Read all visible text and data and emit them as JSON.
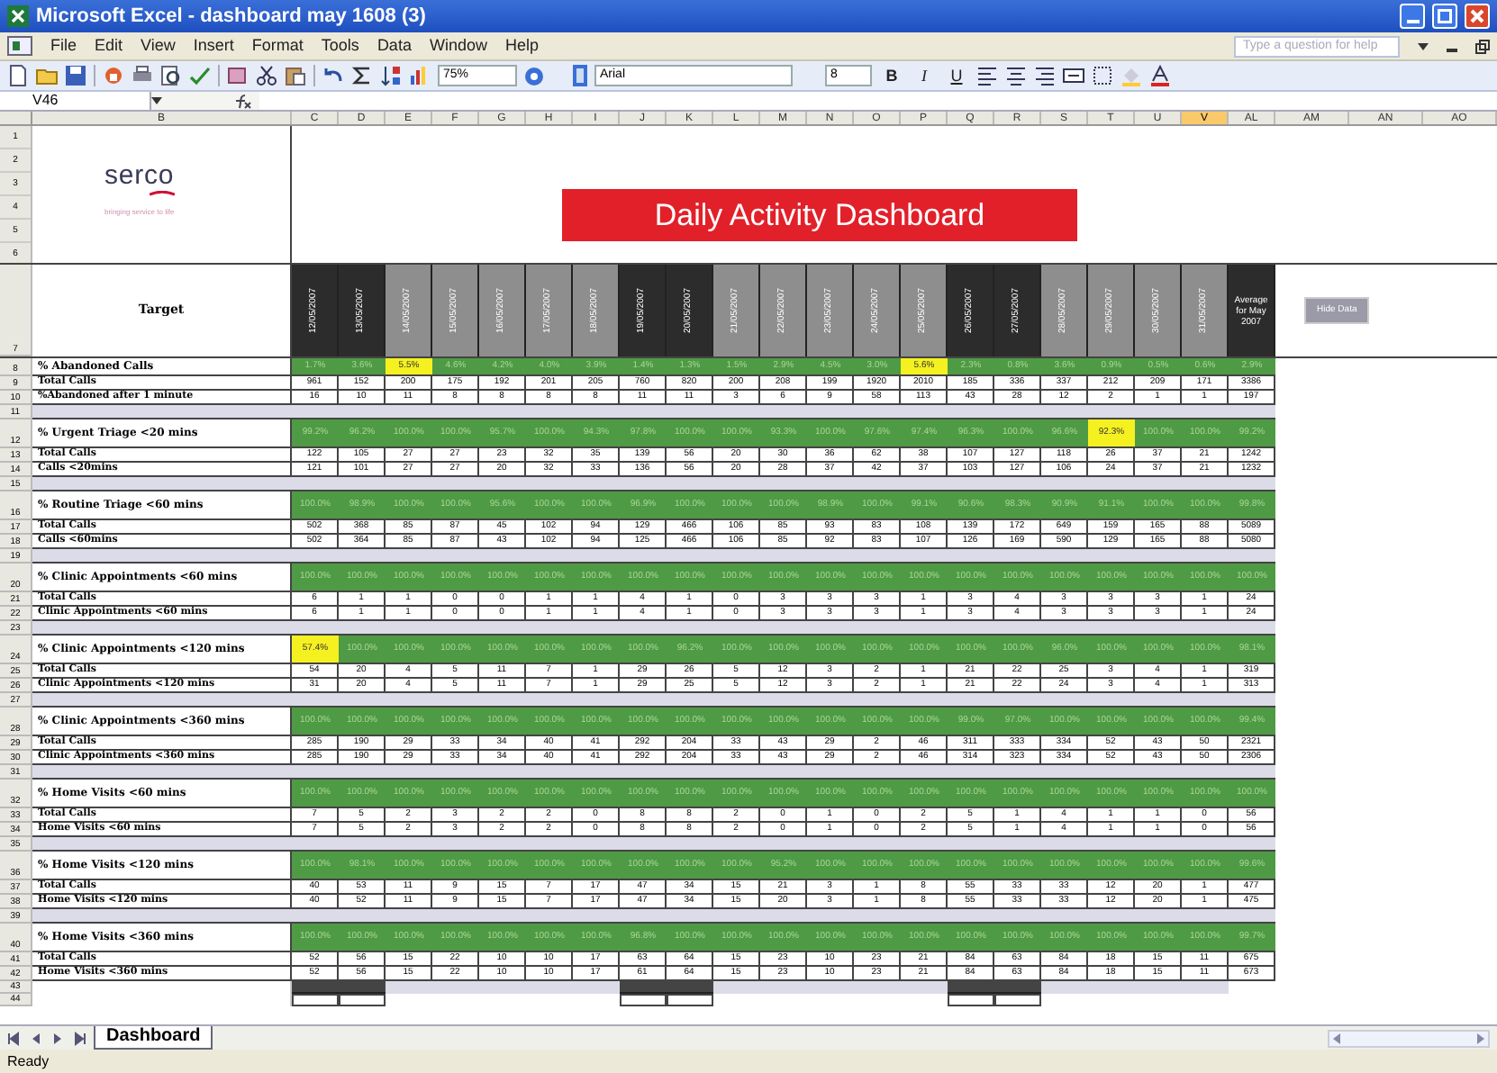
{
  "window": {
    "title": "Microsoft Excel - dashboard may 1608 (3)"
  },
  "menu": [
    "File",
    "Edit",
    "View",
    "Insert",
    "Format",
    "Tools",
    "Data",
    "Window",
    "Help"
  ],
  "help_search": {
    "placeholder": "Type a question for help"
  },
  "toolbar": {
    "zoom": "75%",
    "font": "Arial",
    "font_size": "8",
    "format_buttons": [
      "B",
      "I",
      "U"
    ]
  },
  "name_box": "V46",
  "column_headers": [
    {
      "label": "B",
      "selected": false
    },
    {
      "label": "C",
      "selected": false
    },
    {
      "label": "D",
      "selected": false
    },
    {
      "label": "E",
      "selected": false
    },
    {
      "label": "F",
      "selected": false
    },
    {
      "label": "G",
      "selected": false
    },
    {
      "label": "H",
      "selected": false
    },
    {
      "label": "I",
      "selected": false
    },
    {
      "label": "J",
      "selected": false
    },
    {
      "label": "K",
      "selected": false
    },
    {
      "label": "L",
      "selected": false
    },
    {
      "label": "M",
      "selected": false
    },
    {
      "label": "N",
      "selected": false
    },
    {
      "label": "O",
      "selected": false
    },
    {
      "label": "P",
      "selected": false
    },
    {
      "label": "Q",
      "selected": false
    },
    {
      "label": "R",
      "selected": false
    },
    {
      "label": "S",
      "selected": false
    },
    {
      "label": "T",
      "selected": false
    },
    {
      "label": "U",
      "selected": false
    },
    {
      "label": "V",
      "selected": true
    },
    {
      "label": "AL",
      "selected": false
    },
    {
      "label": "AM",
      "selected": false
    },
    {
      "label": "AN",
      "selected": false
    },
    {
      "label": "AO",
      "selected": false
    }
  ],
  "logo": {
    "name": "serco",
    "tagline": "bringing service to life"
  },
  "banner": "Daily Activity Dashboard",
  "header_row_numbers": [
    "1",
    "2",
    "3",
    "4",
    "5",
    "6"
  ],
  "date_row": {
    "row_number": "7",
    "label": "Target",
    "average_label": "Average for May 2007"
  },
  "dates": [
    {
      "label": "12/05/2007",
      "weekend": true
    },
    {
      "label": "13/05/2007",
      "weekend": true
    },
    {
      "label": "14/05/2007",
      "weekend": false
    },
    {
      "label": "15/05/2007",
      "weekend": false
    },
    {
      "label": "16/05/2007",
      "weekend": false
    },
    {
      "label": "17/05/2007",
      "weekend": false
    },
    {
      "label": "18/05/2007",
      "weekend": false
    },
    {
      "label": "19/05/2007",
      "weekend": true
    },
    {
      "label": "20/05/2007",
      "weekend": true
    },
    {
      "label": "21/05/2007",
      "weekend": false
    },
    {
      "label": "22/05/2007",
      "weekend": false
    },
    {
      "label": "23/05/2007",
      "weekend": false
    },
    {
      "label": "24/05/2007",
      "weekend": false
    },
    {
      "label": "25/05/2007",
      "weekend": false
    },
    {
      "label": "26/05/2007",
      "weekend": true
    },
    {
      "label": "27/05/2007",
      "weekend": true
    },
    {
      "label": "28/05/2007",
      "weekend": false
    },
    {
      "label": "29/05/2007",
      "weekend": false
    },
    {
      "label": "30/05/2007",
      "weekend": false
    },
    {
      "label": "31/05/2007",
      "weekend": false
    }
  ],
  "hide_button": "Hide Data",
  "sections": [
    {
      "row_number": "8",
      "title": "% Abandoned Calls",
      "cells": [
        {
          "v": "1.7%",
          "flagged": false
        },
        {
          "v": "3.6%",
          "flagged": false
        },
        {
          "v": "5.5%",
          "flagged": true
        },
        {
          "v": "4.6%",
          "flagged": false
        },
        {
          "v": "4.2%",
          "flagged": false
        },
        {
          "v": "4.0%",
          "flagged": false
        },
        {
          "v": "3.9%",
          "flagged": false
        },
        {
          "v": "1.4%",
          "flagged": false
        },
        {
          "v": "1.3%",
          "flagged": false
        },
        {
          "v": "1.5%",
          "flagged": false
        },
        {
          "v": "2.9%",
          "flagged": false
        },
        {
          "v": "4.5%",
          "flagged": false
        },
        {
          "v": "3.0%",
          "flagged": false
        },
        {
          "v": "5.6%",
          "flagged": true
        },
        {
          "v": "2.3%",
          "flagged": false
        },
        {
          "v": "0.8%",
          "flagged": false
        },
        {
          "v": "3.6%",
          "flagged": false
        },
        {
          "v": "0.9%",
          "flagged": false
        },
        {
          "v": "0.5%",
          "flagged": false
        },
        {
          "v": "0.6%",
          "flagged": false
        },
        {
          "v": "2.9%",
          "flagged": false
        }
      ],
      "rows": [
        {
          "row_number": "9",
          "label": "Total Calls",
          "values": [
            "961",
            "152",
            "200",
            "175",
            "192",
            "201",
            "205",
            "760",
            "820",
            "200",
            "208",
            "199",
            "1920",
            "2010",
            "185",
            "336",
            "337",
            "212",
            "209",
            "171",
            "3386"
          ]
        },
        {
          "row_number": "10",
          "label": "%Abandoned after 1 minute",
          "values": [
            "16",
            "10",
            "11",
            "8",
            "8",
            "8",
            "8",
            "11",
            "11",
            "3",
            "6",
            "9",
            "58",
            "113",
            "43",
            "28",
            "12",
            "2",
            "1",
            "1",
            "197"
          ]
        }
      ],
      "spacer": "11"
    },
    {
      "row_number": "12",
      "title": "% Urgent Triage <20 mins",
      "cells": [
        {
          "v": "99.2%",
          "flagged": false
        },
        {
          "v": "96.2%",
          "flagged": false
        },
        {
          "v": "100.0%",
          "flagged": false
        },
        {
          "v": "100.0%",
          "flagged": false
        },
        {
          "v": "95.7%",
          "flagged": false
        },
        {
          "v": "100.0%",
          "flagged": false
        },
        {
          "v": "94.3%",
          "flagged": false
        },
        {
          "v": "97.8%",
          "flagged": false
        },
        {
          "v": "100.0%",
          "flagged": false
        },
        {
          "v": "100.0%",
          "flagged": false
        },
        {
          "v": "93.3%",
          "flagged": false
        },
        {
          "v": "100.0%",
          "flagged": false
        },
        {
          "v": "97.6%",
          "flagged": false
        },
        {
          "v": "97.4%",
          "flagged": false
        },
        {
          "v": "96.3%",
          "flagged": false
        },
        {
          "v": "100.0%",
          "flagged": false
        },
        {
          "v": "96.6%",
          "flagged": false
        },
        {
          "v": "92.3%",
          "flagged": true
        },
        {
          "v": "100.0%",
          "flagged": false
        },
        {
          "v": "100.0%",
          "flagged": false
        },
        {
          "v": "99.2%",
          "flagged": false
        }
      ],
      "rows": [
        {
          "row_number": "13",
          "label": "Total Calls",
          "values": [
            "122",
            "105",
            "27",
            "27",
            "23",
            "32",
            "35",
            "139",
            "56",
            "20",
            "30",
            "36",
            "62",
            "38",
            "107",
            "127",
            "118",
            "26",
            "37",
            "21",
            "1242"
          ]
        },
        {
          "row_number": "14",
          "label": "Calls <20mins",
          "values": [
            "121",
            "101",
            "27",
            "27",
            "20",
            "32",
            "33",
            "136",
            "56",
            "20",
            "28",
            "37",
            "42",
            "37",
            "103",
            "127",
            "106",
            "24",
            "37",
            "21",
            "1232"
          ]
        }
      ],
      "spacer": "15"
    },
    {
      "row_number": "16",
      "title": "% Routine Triage <60 mins",
      "cells": [
        {
          "v": "100.0%",
          "flagged": false
        },
        {
          "v": "98.9%",
          "flagged": false
        },
        {
          "v": "100.0%",
          "flagged": false
        },
        {
          "v": "100.0%",
          "flagged": false
        },
        {
          "v": "95.6%",
          "flagged": false
        },
        {
          "v": "100.0%",
          "flagged": false
        },
        {
          "v": "100.0%",
          "flagged": false
        },
        {
          "v": "96.9%",
          "flagged": false
        },
        {
          "v": "100.0%",
          "flagged": false
        },
        {
          "v": "100.0%",
          "flagged": false
        },
        {
          "v": "100.0%",
          "flagged": false
        },
        {
          "v": "98.9%",
          "flagged": false
        },
        {
          "v": "100.0%",
          "flagged": false
        },
        {
          "v": "99.1%",
          "flagged": false
        },
        {
          "v": "90.6%",
          "flagged": false
        },
        {
          "v": "98.3%",
          "flagged": false
        },
        {
          "v": "90.9%",
          "flagged": false
        },
        {
          "v": "91.1%",
          "flagged": false
        },
        {
          "v": "100.0%",
          "flagged": false
        },
        {
          "v": "100.0%",
          "flagged": false
        },
        {
          "v": "99.8%",
          "flagged": false
        }
      ],
      "rows": [
        {
          "row_number": "17",
          "label": "Total Calls",
          "values": [
            "502",
            "368",
            "85",
            "87",
            "45",
            "102",
            "94",
            "129",
            "466",
            "106",
            "85",
            "93",
            "83",
            "108",
            "139",
            "172",
            "649",
            "159",
            "165",
            "88",
            "5089"
          ]
        },
        {
          "row_number": "18",
          "label": "Calls <60mins",
          "values": [
            "502",
            "364",
            "85",
            "87",
            "43",
            "102",
            "94",
            "125",
            "466",
            "106",
            "85",
            "92",
            "83",
            "107",
            "126",
            "169",
            "590",
            "129",
            "165",
            "88",
            "5080"
          ]
        }
      ],
      "spacer": "19"
    },
    {
      "row_number": "20",
      "title": "% Clinic Appointments <60 mins",
      "cells": [
        {
          "v": "100.0%",
          "flagged": false
        },
        {
          "v": "100.0%",
          "flagged": false
        },
        {
          "v": "100.0%",
          "flagged": false
        },
        {
          "v": "100.0%",
          "flagged": false
        },
        {
          "v": "100.0%",
          "flagged": false
        },
        {
          "v": "100.0%",
          "flagged": false
        },
        {
          "v": "100.0%",
          "flagged": false
        },
        {
          "v": "100.0%",
          "flagged": false
        },
        {
          "v": "100.0%",
          "flagged": false
        },
        {
          "v": "100.0%",
          "flagged": false
        },
        {
          "v": "100.0%",
          "flagged": false
        },
        {
          "v": "100.0%",
          "flagged": false
        },
        {
          "v": "100.0%",
          "flagged": false
        },
        {
          "v": "100.0%",
          "flagged": false
        },
        {
          "v": "100.0%",
          "flagged": false
        },
        {
          "v": "100.0%",
          "flagged": false
        },
        {
          "v": "100.0%",
          "flagged": false
        },
        {
          "v": "100.0%",
          "flagged": false
        },
        {
          "v": "100.0%",
          "flagged": false
        },
        {
          "v": "100.0%",
          "flagged": false
        },
        {
          "v": "100.0%",
          "flagged": false
        }
      ],
      "rows": [
        {
          "row_number": "21",
          "label": "Total Calls",
          "values": [
            "6",
            "1",
            "1",
            "0",
            "0",
            "1",
            "1",
            "4",
            "1",
            "0",
            "3",
            "3",
            "3",
            "1",
            "3",
            "4",
            "3",
            "3",
            "3",
            "1",
            "24"
          ]
        },
        {
          "row_number": "22",
          "label": "Clinic Appointments <60 mins",
          "values": [
            "6",
            "1",
            "1",
            "0",
            "0",
            "1",
            "1",
            "4",
            "1",
            "0",
            "3",
            "3",
            "3",
            "1",
            "3",
            "4",
            "3",
            "3",
            "3",
            "1",
            "24"
          ]
        }
      ],
      "spacer": "23"
    },
    {
      "row_number": "24",
      "title": "% Clinic Appointments <120 mins",
      "cells": [
        {
          "v": "57.4%",
          "flagged": true
        },
        {
          "v": "100.0%",
          "flagged": false
        },
        {
          "v": "100.0%",
          "flagged": false
        },
        {
          "v": "100.0%",
          "flagged": false
        },
        {
          "v": "100.0%",
          "flagged": false
        },
        {
          "v": "100.0%",
          "flagged": false
        },
        {
          "v": "100.0%",
          "flagged": false
        },
        {
          "v": "100.0%",
          "flagged": false
        },
        {
          "v": "96.2%",
          "flagged": false
        },
        {
          "v": "100.0%",
          "flagged": false
        },
        {
          "v": "100.0%",
          "flagged": false
        },
        {
          "v": "100.0%",
          "flagged": false
        },
        {
          "v": "100.0%",
          "flagged": false
        },
        {
          "v": "100.0%",
          "flagged": false
        },
        {
          "v": "100.0%",
          "flagged": false
        },
        {
          "v": "100.0%",
          "flagged": false
        },
        {
          "v": "96.0%",
          "flagged": false
        },
        {
          "v": "100.0%",
          "flagged": false
        },
        {
          "v": "100.0%",
          "flagged": false
        },
        {
          "v": "100.0%",
          "flagged": false
        },
        {
          "v": "98.1%",
          "flagged": false
        }
      ],
      "rows": [
        {
          "row_number": "25",
          "label": "Total Calls",
          "values": [
            "54",
            "20",
            "4",
            "5",
            "11",
            "7",
            "1",
            "29",
            "26",
            "5",
            "12",
            "3",
            "2",
            "1",
            "21",
            "22",
            "25",
            "3",
            "4",
            "1",
            "319"
          ]
        },
        {
          "row_number": "26",
          "label": "Clinic Appointments **<120** mins",
          "values": [
            "31",
            "20",
            "4",
            "5",
            "11",
            "7",
            "1",
            "29",
            "25",
            "5",
            "12",
            "3",
            "2",
            "1",
            "21",
            "22",
            "24",
            "3",
            "4",
            "1",
            "313"
          ]
        }
      ],
      "spacer": "27"
    },
    {
      "row_number": "28",
      "title": "% Clinic Appointments <360 mins",
      "cells": [
        {
          "v": "100.0%",
          "flagged": false
        },
        {
          "v": "100.0%",
          "flagged": false
        },
        {
          "v": "100.0%",
          "flagged": false
        },
        {
          "v": "100.0%",
          "flagged": false
        },
        {
          "v": "100.0%",
          "flagged": false
        },
        {
          "v": "100.0%",
          "flagged": false
        },
        {
          "v": "100.0%",
          "flagged": false
        },
        {
          "v": "100.0%",
          "flagged": false
        },
        {
          "v": "100.0%",
          "flagged": false
        },
        {
          "v": "100.0%",
          "flagged": false
        },
        {
          "v": "100.0%",
          "flagged": false
        },
        {
          "v": "100.0%",
          "flagged": false
        },
        {
          "v": "100.0%",
          "flagged": false
        },
        {
          "v": "100.0%",
          "flagged": false
        },
        {
          "v": "99.0%",
          "flagged": false
        },
        {
          "v": "97.0%",
          "flagged": false
        },
        {
          "v": "100.0%",
          "flagged": false
        },
        {
          "v": "100.0%",
          "flagged": false
        },
        {
          "v": "100.0%",
          "flagged": false
        },
        {
          "v": "100.0%",
          "flagged": false
        },
        {
          "v": "99.4%",
          "flagged": false
        }
      ],
      "rows": [
        {
          "row_number": "29",
          "label": "Total Calls",
          "values": [
            "285",
            "190",
            "29",
            "33",
            "34",
            "40",
            "41",
            "292",
            "204",
            "33",
            "43",
            "29",
            "2",
            "46",
            "311",
            "333",
            "334",
            "52",
            "43",
            "50",
            "2321"
          ]
        },
        {
          "row_number": "30",
          "label": "Clinic Appointments <360 mins",
          "values": [
            "285",
            "190",
            "29",
            "33",
            "34",
            "40",
            "41",
            "292",
            "204",
            "33",
            "43",
            "29",
            "2",
            "46",
            "314",
            "323",
            "334",
            "52",
            "43",
            "50",
            "2306"
          ]
        }
      ],
      "spacer": "31"
    },
    {
      "row_number": "32",
      "title": "% Home Visits <60 mins",
      "cells": [
        {
          "v": "100.0%",
          "flagged": false
        },
        {
          "v": "100.0%",
          "flagged": false
        },
        {
          "v": "100.0%",
          "flagged": false
        },
        {
          "v": "100.0%",
          "flagged": false
        },
        {
          "v": "100.0%",
          "flagged": false
        },
        {
          "v": "100.0%",
          "flagged": false
        },
        {
          "v": "100.0%",
          "flagged": false
        },
        {
          "v": "100.0%",
          "flagged": false
        },
        {
          "v": "100.0%",
          "flagged": false
        },
        {
          "v": "100.0%",
          "flagged": false
        },
        {
          "v": "100.0%",
          "flagged": false
        },
        {
          "v": "100.0%",
          "flagged": false
        },
        {
          "v": "100.0%",
          "flagged": false
        },
        {
          "v": "100.0%",
          "flagged": false
        },
        {
          "v": "100.0%",
          "flagged": false
        },
        {
          "v": "100.0%",
          "flagged": false
        },
        {
          "v": "100.0%",
          "flagged": false
        },
        {
          "v": "100.0%",
          "flagged": false
        },
        {
          "v": "100.0%",
          "flagged": false
        },
        {
          "v": "100.0%",
          "flagged": false
        },
        {
          "v": "100.0%",
          "flagged": false
        }
      ],
      "rows": [
        {
          "row_number": "33",
          "label": "Total Calls",
          "values": [
            "7",
            "5",
            "2",
            "3",
            "2",
            "2",
            "0",
            "8",
            "8",
            "2",
            "0",
            "1",
            "0",
            "2",
            "5",
            "1",
            "4",
            "1",
            "1",
            "0",
            "56"
          ]
        },
        {
          "row_number": "34",
          "label": "Home Visits <60 mins",
          "values": [
            "7",
            "5",
            "2",
            "3",
            "2",
            "2",
            "0",
            "8",
            "8",
            "2",
            "0",
            "1",
            "0",
            "2",
            "5",
            "1",
            "4",
            "1",
            "1",
            "0",
            "56"
          ]
        }
      ],
      "spacer": "35"
    },
    {
      "row_number": "36",
      "title": "% Home Visits <120 mins",
      "cells": [
        {
          "v": "100.0%",
          "flagged": false
        },
        {
          "v": "98.1%",
          "flagged": false
        },
        {
          "v": "100.0%",
          "flagged": false
        },
        {
          "v": "100.0%",
          "flagged": false
        },
        {
          "v": "100.0%",
          "flagged": false
        },
        {
          "v": "100.0%",
          "flagged": false
        },
        {
          "v": "100.0%",
          "flagged": false
        },
        {
          "v": "100.0%",
          "flagged": false
        },
        {
          "v": "100.0%",
          "flagged": false
        },
        {
          "v": "100.0%",
          "flagged": false
        },
        {
          "v": "95.2%",
          "flagged": false
        },
        {
          "v": "100.0%",
          "flagged": false
        },
        {
          "v": "100.0%",
          "flagged": false
        },
        {
          "v": "100.0%",
          "flagged": false
        },
        {
          "v": "100.0%",
          "flagged": false
        },
        {
          "v": "100.0%",
          "flagged": false
        },
        {
          "v": "100.0%",
          "flagged": false
        },
        {
          "v": "100.0%",
          "flagged": false
        },
        {
          "v": "100.0%",
          "flagged": false
        },
        {
          "v": "100.0%",
          "flagged": false
        },
        {
          "v": "99.6%",
          "flagged": false
        }
      ],
      "rows": [
        {
          "row_number": "37",
          "label": "Total Calls",
          "values": [
            "40",
            "53",
            "11",
            "9",
            "15",
            "7",
            "17",
            "47",
            "34",
            "15",
            "21",
            "3",
            "1",
            "8",
            "55",
            "33",
            "33",
            "12",
            "20",
            "1",
            "477"
          ]
        },
        {
          "row_number": "38",
          "label": "Home Visits <120 mins",
          "values": [
            "40",
            "52",
            "11",
            "9",
            "15",
            "7",
            "17",
            "47",
            "34",
            "15",
            "20",
            "3",
            "1",
            "8",
            "55",
            "33",
            "33",
            "12",
            "20",
            "1",
            "475"
          ]
        }
      ],
      "spacer": "39"
    },
    {
      "row_number": "40",
      "title": "% Home Visits <360 mins",
      "cells": [
        {
          "v": "100.0%",
          "flagged": false
        },
        {
          "v": "100.0%",
          "flagged": false
        },
        {
          "v": "100.0%",
          "flagged": false
        },
        {
          "v": "100.0%",
          "flagged": false
        },
        {
          "v": "100.0%",
          "flagged": false
        },
        {
          "v": "100.0%",
          "flagged": false
        },
        {
          "v": "100.0%",
          "flagged": false
        },
        {
          "v": "96.8%",
          "flagged": false
        },
        {
          "v": "100.0%",
          "flagged": false
        },
        {
          "v": "100.0%",
          "flagged": false
        },
        {
          "v": "100.0%",
          "flagged": false
        },
        {
          "v": "100.0%",
          "flagged": false
        },
        {
          "v": "100.0%",
          "flagged": false
        },
        {
          "v": "100.0%",
          "flagged": false
        },
        {
          "v": "100.0%",
          "flagged": false
        },
        {
          "v": "100.0%",
          "flagged": false
        },
        {
          "v": "100.0%",
          "flagged": false
        },
        {
          "v": "100.0%",
          "flagged": false
        },
        {
          "v": "100.0%",
          "flagged": false
        },
        {
          "v": "100.0%",
          "flagged": false
        },
        {
          "v": "99.7%",
          "flagged": false
        }
      ],
      "rows": [
        {
          "row_number": "41",
          "label": "Total Calls",
          "values": [
            "52",
            "56",
            "15",
            "22",
            "10",
            "10",
            "17",
            "63",
            "64",
            "15",
            "23",
            "10",
            "23",
            "21",
            "84",
            "63",
            "84",
            "18",
            "15",
            "11",
            "675"
          ]
        },
        {
          "row_number": "42",
          "label": "Home Visits <360 mins",
          "values": [
            "52",
            "56",
            "15",
            "22",
            "10",
            "10",
            "17",
            "61",
            "64",
            "15",
            "23",
            "10",
            "23",
            "21",
            "84",
            "63",
            "84",
            "18",
            "15",
            "11",
            "673"
          ]
        }
      ]
    }
  ],
  "footer_rows": [
    "43",
    "44"
  ],
  "sheet_tabs": [
    {
      "label": "Dashboard",
      "selected": true
    }
  ],
  "status_bar": "Ready"
}
